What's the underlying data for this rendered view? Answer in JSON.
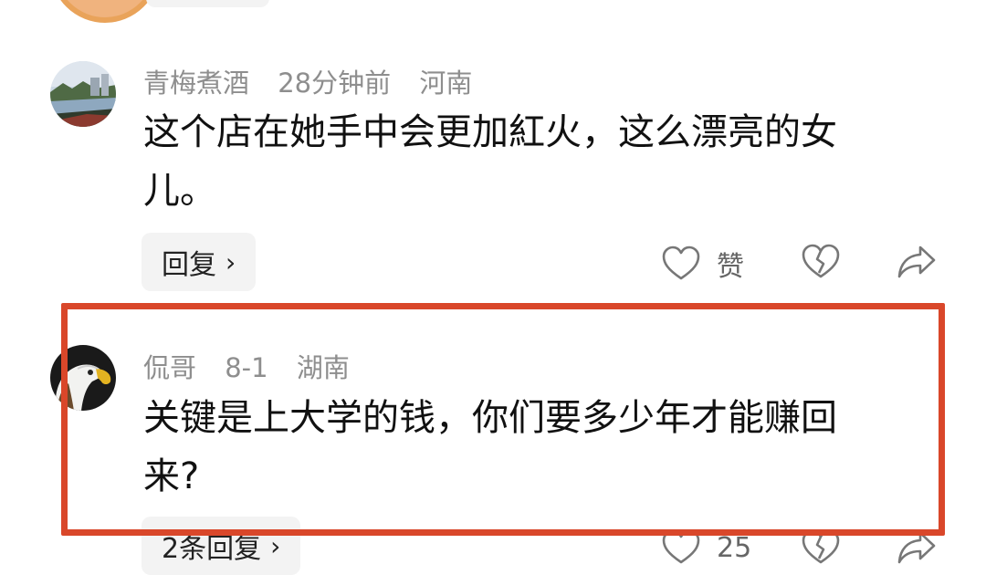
{
  "comments": [
    {
      "author": "青梅煮酒",
      "time": "28分钟前",
      "location": "河南",
      "text_line1": "这个店在她手中会更加紅火，这么漂亮的女",
      "text_line2": "儿。",
      "reply_label": "回复",
      "like_label": "赞"
    },
    {
      "author": "侃哥",
      "time": "8-1",
      "location": "湖南",
      "text_line1": "关键是上大学的钱，你们要多少年才能赚回",
      "text_line2": "来?",
      "reply_label": "2条回复",
      "like_count": "25"
    }
  ],
  "icons": {
    "chevron": "chevron-right-icon",
    "like": "heart-outline-icon",
    "dislike": "broken-heart-icon",
    "share": "share-arrow-icon"
  },
  "colors": {
    "highlight": "#d9472a",
    "meta_text": "#8e8e8e",
    "pill_bg": "#f3f3f3"
  }
}
